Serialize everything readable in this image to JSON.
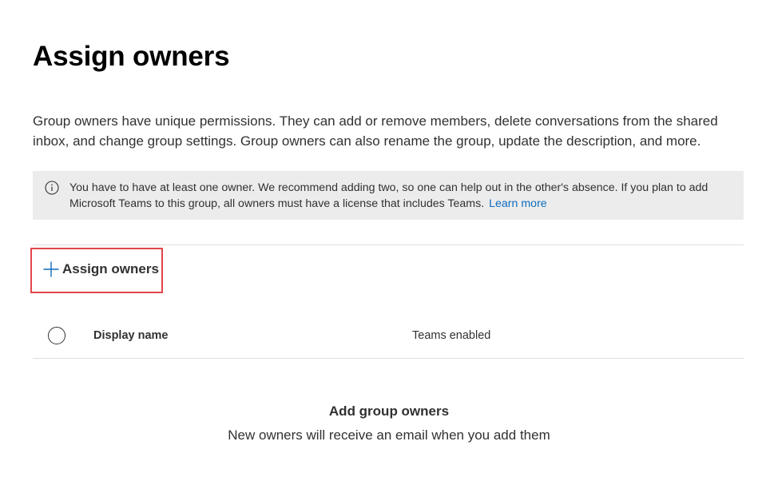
{
  "page": {
    "title": "Assign owners",
    "description": "Group owners have unique permissions. They can add or remove members, delete conversations from the shared inbox, and change group settings. Group owners can also rename the group, update the description, and more."
  },
  "info_bar": {
    "icon": "info-icon",
    "text": "You have to have at least one owner. We recommend adding two, so one can help out in the other's absence. If you plan to add Microsoft Teams to this group, all owners must have a license that includes Teams.",
    "link_label": "Learn more"
  },
  "toolbar": {
    "assign_icon": "plus-icon",
    "assign_label": "Assign owners"
  },
  "table": {
    "columns": [
      "Display name",
      "Teams enabled"
    ]
  },
  "empty_state": {
    "title": "Add group owners",
    "subtitle": "New owners will receive an email when you add them"
  },
  "colors": {
    "accent": "#0f6cbd",
    "highlight_border": "#e3464b",
    "info_background": "#ececec"
  }
}
